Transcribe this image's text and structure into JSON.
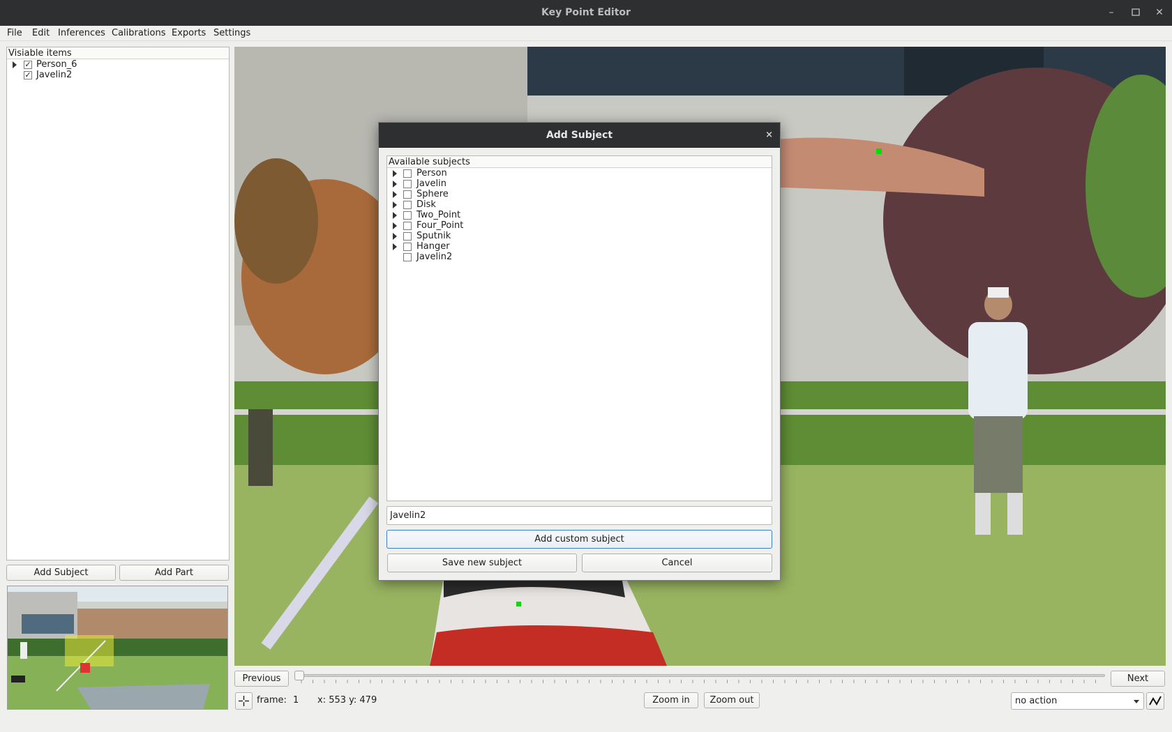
{
  "window": {
    "title": "Key Point Editor"
  },
  "menu": [
    "File",
    "Edit",
    "Inferences",
    "Calibrations",
    "Exports",
    "Settings"
  ],
  "visible_panel": {
    "header": "Visiable items",
    "items": [
      {
        "label": "Person_6",
        "checked": "✓",
        "expandable": true
      },
      {
        "label": "Javelin2",
        "checked": "✓",
        "expandable": false
      }
    ],
    "add_subject_label": "Add Subject",
    "add_part_label": "Add Part"
  },
  "dialog": {
    "title": "Add Subject",
    "close": "×",
    "list_header": "Available subjects",
    "subjects": [
      {
        "label": "Person",
        "expandable": true
      },
      {
        "label": "Javelin",
        "expandable": true
      },
      {
        "label": "Sphere",
        "expandable": true
      },
      {
        "label": "Disk",
        "expandable": true
      },
      {
        "label": "Two_Point",
        "expandable": true
      },
      {
        "label": "Four_Point",
        "expandable": true
      },
      {
        "label": "Sputnik",
        "expandable": true
      },
      {
        "label": "Hanger",
        "expandable": true
      },
      {
        "label": "Javelin2",
        "expandable": false
      }
    ],
    "name_value": "Javelin2",
    "add_custom_label": "Add custom subject",
    "save_label": "Save new subject",
    "cancel_label": "Cancel"
  },
  "nav": {
    "previous_label": "Previous",
    "next_label": "Next"
  },
  "status": {
    "frame_label": "frame:",
    "frame_value": "1",
    "coords": "x: 553 y: 479",
    "zoom_in_label": "Zoom in",
    "zoom_out_label": "Zoom out",
    "action_value": "no action"
  },
  "colors": {
    "titlebar": "#2d2f30",
    "keypoint": "#00e000",
    "focus_border": "#3d7ec9"
  }
}
